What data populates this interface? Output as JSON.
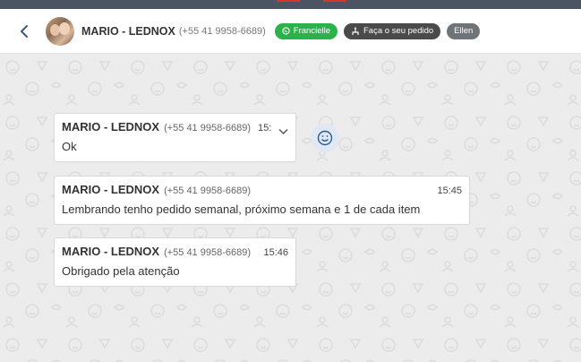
{
  "header": {
    "contact_name": "MARIO - LEDNOX",
    "contact_phone": "(+55 41 9958-6689)",
    "tags": [
      {
        "label": "Francielle",
        "icon": "whatsapp-icon",
        "color": "#2bb34a"
      },
      {
        "label": "Faça o seu pedido",
        "icon": "flow-icon",
        "color": "#4a4a4a"
      },
      {
        "label": "Ellen",
        "color": "#6f7478"
      }
    ]
  },
  "messages": [
    {
      "sender": "MARIO - LEDNOX",
      "phone": "(+55 41 9958-6689)",
      "time": "15:",
      "text": "Ok"
    },
    {
      "sender": "MARIO - LEDNOX",
      "phone": "(+55 41 9958-6689)",
      "time": "15:45",
      "text": "Lembrando tenho pedido semanal, próximo semana e 1 de cada item"
    },
    {
      "sender": "MARIO - LEDNOX",
      "phone": "(+55 41 9958-6689)",
      "time": "15:46",
      "text": "Obrigado pela atenção"
    }
  ]
}
